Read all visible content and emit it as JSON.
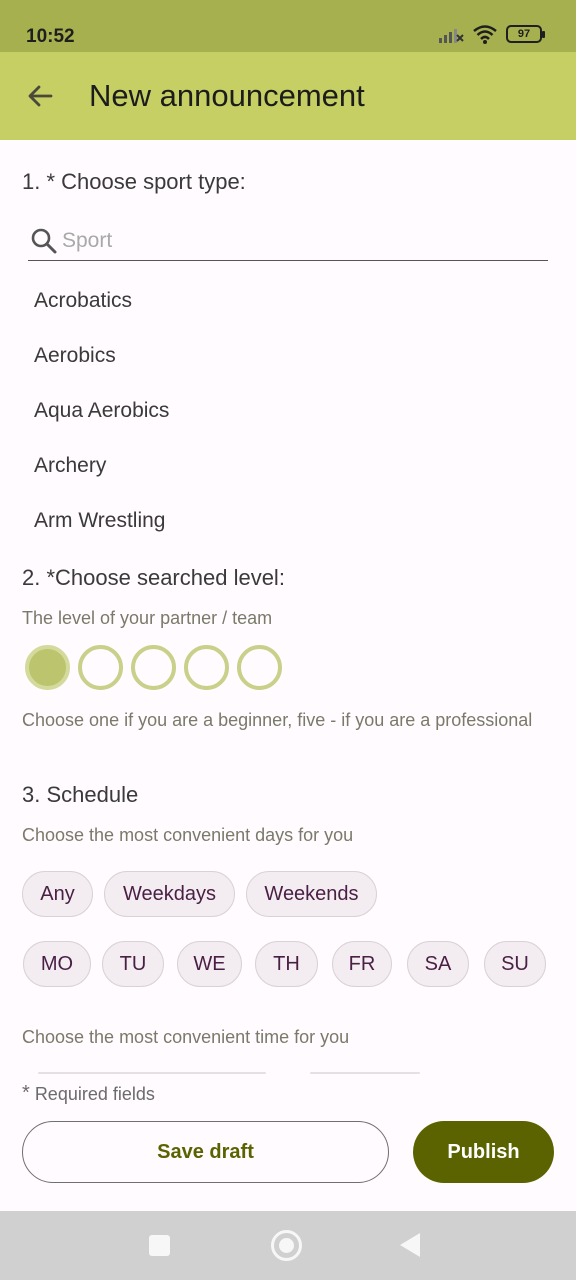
{
  "status_bar": {
    "time": "10:52",
    "battery": "97"
  },
  "app_bar": {
    "title": "New announcement"
  },
  "section1": {
    "title": "1. * Choose sport type:",
    "search_placeholder": "Sport",
    "search_value": "",
    "sports": [
      "Acrobatics",
      "Aerobics",
      "Aqua Aerobics",
      "Archery",
      "Arm Wrestling"
    ]
  },
  "section2": {
    "title": "2. *Choose searched level:",
    "subtitle": "The level of your partner / team",
    "selected_level": 1,
    "level_count": 5,
    "hint": "Choose one if you are a beginner, five - if you are a professional"
  },
  "section3": {
    "title": "3. Schedule",
    "days_hint": "Choose the most convenient days for you",
    "day_groups": [
      "Any",
      "Weekdays",
      "Weekends"
    ],
    "days": [
      "MO",
      "TU",
      "WE",
      "TH",
      "FR",
      "SA",
      "SU"
    ],
    "time_hint": "Choose the most convenient time for you"
  },
  "footer": {
    "required_star": "*",
    "required_note": "Required fields",
    "save_label": "Save draft",
    "publish_label": "Publish"
  },
  "colors": {
    "status_bar": "#a6b04e",
    "app_bar": "#c5cf64",
    "primary": "#5b6300",
    "chip_text": "#4a1f44",
    "level_selected": "#bcc46e"
  }
}
